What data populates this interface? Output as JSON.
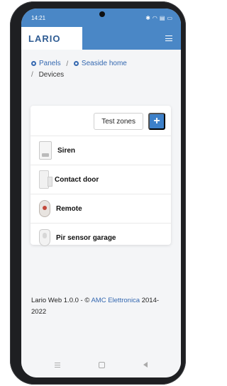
{
  "status_bar": {
    "time": "14:21",
    "icons": [
      "bluetooth-icon",
      "wifi-icon",
      "signal-icon",
      "battery-icon"
    ]
  },
  "header": {
    "logo": "LARIO",
    "menu_icon": "hamburger-icon"
  },
  "breadcrumb": {
    "items": [
      {
        "label": "Panels",
        "icon": "panel-icon"
      },
      {
        "label": "Seaside home",
        "icon": "panel-icon"
      }
    ],
    "current": "Devices"
  },
  "actions": {
    "test_zones_label": "Test zones",
    "add_label": "+"
  },
  "devices": [
    {
      "name": "Siren",
      "icon": "siren-icon"
    },
    {
      "name": "Contact door",
      "icon": "contact-door-icon"
    },
    {
      "name": "Remote",
      "icon": "remote-icon"
    },
    {
      "name": "Pir sensor garage",
      "icon": "pir-sensor-icon"
    }
  ],
  "footer": {
    "prefix": "Lario Web 1.0.0 - © ",
    "link": "AMC Elettronica",
    "suffix": " 2014-2022"
  },
  "colors": {
    "primary": "#4a87c6",
    "button_blue": "#3d80c9",
    "link": "#3468b0"
  }
}
